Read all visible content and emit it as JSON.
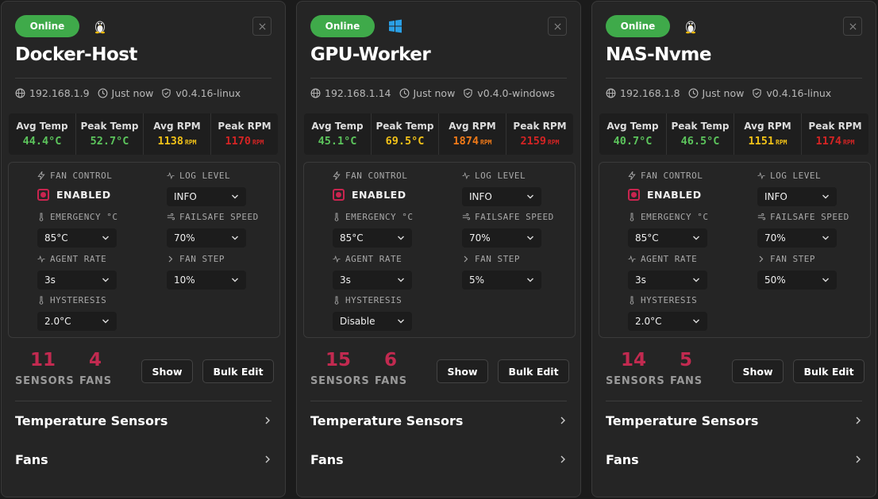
{
  "cards": [
    {
      "status": "Online",
      "os": "linux",
      "name": "Docker-Host",
      "ip": "192.168.1.9",
      "seen": "Just now",
      "version": "v0.4.16-linux",
      "stats": {
        "avg_temp_label": "Avg Temp",
        "avg_temp": "44.4°C",
        "peak_temp_label": "Peak Temp",
        "peak_temp": "52.7°C",
        "avg_rpm_label": "Avg RPM",
        "avg_rpm": "1138",
        "peak_rpm_label": "Peak RPM",
        "peak_rpm": "1170",
        "rpm_unit": "RPM",
        "colors": {
          "avg_temp": "#5cc45c",
          "peak_temp": "#5cc45c",
          "avg_rpm": "#f2c218",
          "peak_rpm": "#d42424"
        }
      },
      "settings": {
        "fan_control_label": "FAN CONTROL",
        "fan_control_value": "ENABLED",
        "log_level_label": "LOG LEVEL",
        "log_level": "INFO",
        "emergency_label": "EMERGENCY °C",
        "emergency": "85°C",
        "failsafe_label": "FAILSAFE SPEED",
        "failsafe": "70%",
        "agent_rate_label": "AGENT RATE",
        "agent_rate": "3s",
        "fan_step_label": "FAN STEP",
        "fan_step": "10%",
        "hysteresis_label": "HYSTERESIS",
        "hysteresis": "2.0°C"
      },
      "sensors_count": "11",
      "sensors_label": "SENSORS",
      "fans_count": "4",
      "fans_label": "FANS",
      "show_label": "Show",
      "bulk_edit_label": "Bulk Edit",
      "temp_sensors_label": "Temperature Sensors",
      "fans_section_label": "Fans"
    },
    {
      "status": "Online",
      "os": "windows",
      "name": "GPU-Worker",
      "ip": "192.168.1.14",
      "seen": "Just now",
      "version": "v0.4.0-windows",
      "stats": {
        "avg_temp_label": "Avg Temp",
        "avg_temp": "45.1°C",
        "peak_temp_label": "Peak Temp",
        "peak_temp": "69.5°C",
        "avg_rpm_label": "Avg RPM",
        "avg_rpm": "1874",
        "peak_rpm_label": "Peak RPM",
        "peak_rpm": "2159",
        "rpm_unit": "RPM",
        "colors": {
          "avg_temp": "#5cc45c",
          "peak_temp": "#f2c218",
          "avg_rpm": "#f27a18",
          "peak_rpm": "#d42424"
        }
      },
      "settings": {
        "fan_control_label": "FAN CONTROL",
        "fan_control_value": "ENABLED",
        "log_level_label": "LOG LEVEL",
        "log_level": "INFO",
        "emergency_label": "EMERGENCY °C",
        "emergency": "85°C",
        "failsafe_label": "FAILSAFE SPEED",
        "failsafe": "70%",
        "agent_rate_label": "AGENT RATE",
        "agent_rate": "3s",
        "fan_step_label": "FAN STEP",
        "fan_step": "5%",
        "hysteresis_label": "HYSTERESIS",
        "hysteresis": "Disable"
      },
      "sensors_count": "15",
      "sensors_label": "SENSORS",
      "fans_count": "6",
      "fans_label": "FANS",
      "show_label": "Show",
      "bulk_edit_label": "Bulk Edit",
      "temp_sensors_label": "Temperature Sensors",
      "fans_section_label": "Fans"
    },
    {
      "status": "Online",
      "os": "linux",
      "name": "NAS-Nvme",
      "ip": "192.168.1.8",
      "seen": "Just now",
      "version": "v0.4.16-linux",
      "stats": {
        "avg_temp_label": "Avg Temp",
        "avg_temp": "40.7°C",
        "peak_temp_label": "Peak Temp",
        "peak_temp": "46.5°C",
        "avg_rpm_label": "Avg RPM",
        "avg_rpm": "1151",
        "peak_rpm_label": "Peak RPM",
        "peak_rpm": "1174",
        "rpm_unit": "RPM",
        "colors": {
          "avg_temp": "#5cc45c",
          "peak_temp": "#5cc45c",
          "avg_rpm": "#f2c218",
          "peak_rpm": "#d42424"
        }
      },
      "settings": {
        "fan_control_label": "FAN CONTROL",
        "fan_control_value": "ENABLED",
        "log_level_label": "LOG LEVEL",
        "log_level": "INFO",
        "emergency_label": "EMERGENCY °C",
        "emergency": "85°C",
        "failsafe_label": "FAILSAFE SPEED",
        "failsafe": "70%",
        "agent_rate_label": "AGENT RATE",
        "agent_rate": "3s",
        "fan_step_label": "FAN STEP",
        "fan_step": "50%",
        "hysteresis_label": "HYSTERESIS",
        "hysteresis": "2.0°C"
      },
      "sensors_count": "14",
      "sensors_label": "SENSORS",
      "fans_count": "5",
      "fans_label": "FANS",
      "show_label": "Show",
      "bulk_edit_label": "Bulk Edit",
      "temp_sensors_label": "Temperature Sensors",
      "fans_section_label": "Fans"
    }
  ],
  "icons": {
    "close": "close-icon",
    "globe": "globe-icon",
    "clock": "clock-icon",
    "shield": "shield-icon"
  }
}
